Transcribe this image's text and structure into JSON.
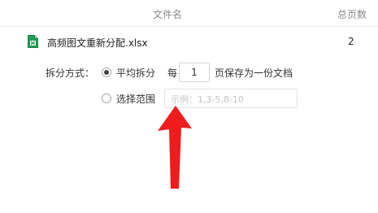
{
  "header": {
    "file_name_col": "文件名",
    "page_count_col": "总页数"
  },
  "file": {
    "name": "高频图文重新分配.xlsx",
    "pages": "2",
    "icon": "excel-file-icon"
  },
  "split": {
    "mode_label": "拆分方式：",
    "average_label": "平均拆分",
    "average_selected": true,
    "every_label": "每",
    "pages_per_file": "1",
    "suffix_label": "页保存为一份文档",
    "range_label": "选择范围",
    "range_selected": false,
    "range_placeholder": "示例：1,3-5,8-10",
    "range_value": ""
  },
  "annotation": {
    "icon": "red-arrow-icon",
    "color": "#ee1c1c"
  }
}
